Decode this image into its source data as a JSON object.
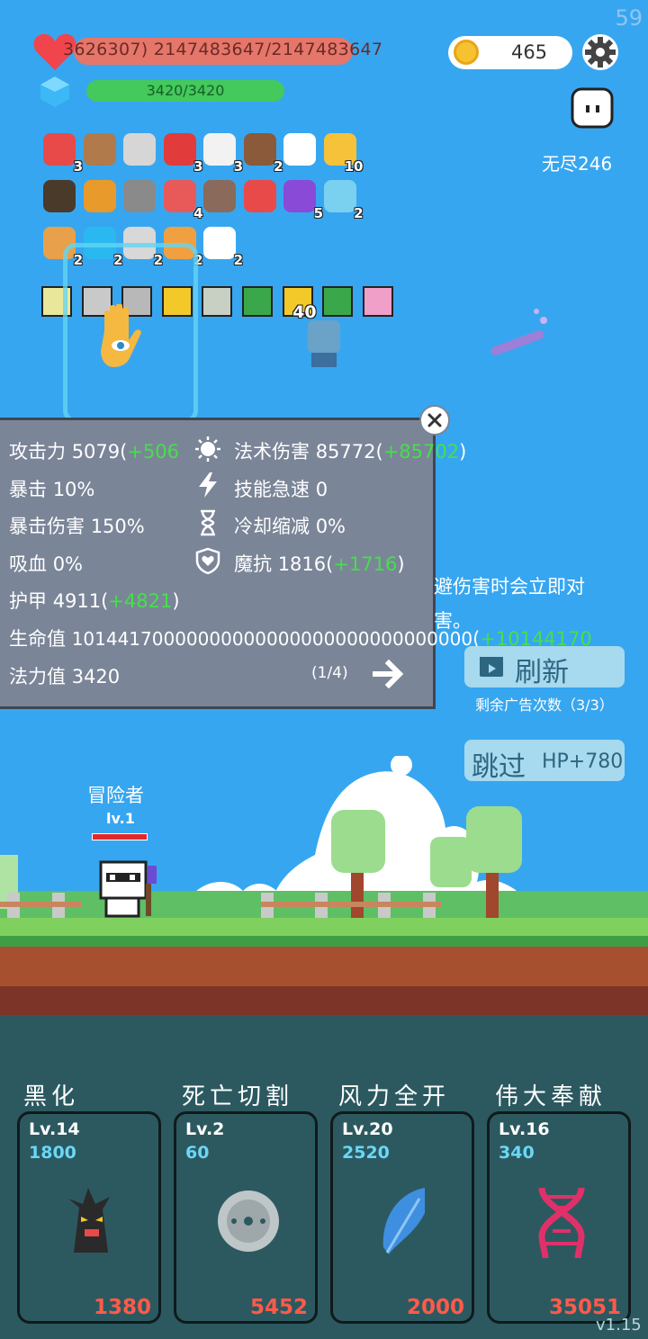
{
  "fps": "59",
  "player_stats": {
    "hp_text": "3626307) 2147483647/2147483647",
    "mp_text": "3420/3420"
  },
  "coins": "465",
  "mode_label": "无尽246",
  "items": [
    {
      "icon": "watermelon-icon",
      "count": "3"
    },
    {
      "icon": "shield-icon",
      "count": ""
    },
    {
      "icon": "sword-icon",
      "count": ""
    },
    {
      "icon": "strawberry-icon",
      "count": "3"
    },
    {
      "icon": "envelope-icon",
      "count": "3"
    },
    {
      "icon": "coconut-icon",
      "count": "2"
    },
    {
      "icon": "crosshair-icon",
      "count": ""
    },
    {
      "icon": "sunflower-icon",
      "count": "10"
    },
    {
      "icon": "cauldron-icon",
      "count": ""
    },
    {
      "icon": "book-icon",
      "count": ""
    },
    {
      "icon": "helmet-icon",
      "count": ""
    },
    {
      "icon": "pill-icon",
      "count": "4"
    },
    {
      "icon": "tombstone-icon",
      "count": ""
    },
    {
      "icon": "badge-icon",
      "count": ""
    },
    {
      "icon": "crystal-ball-icon",
      "count": "5"
    },
    {
      "icon": "potion-icon",
      "count": "2"
    },
    {
      "icon": "drink-icon",
      "count": "2"
    },
    {
      "icon": "gem-icon",
      "count": "2"
    },
    {
      "icon": "hook-icon",
      "count": "2"
    },
    {
      "icon": "meteor-icon",
      "count": "2"
    },
    {
      "icon": "ghost-icon",
      "count": "2"
    }
  ],
  "relics": [
    {
      "icon": "light-relic-icon",
      "count": ""
    },
    {
      "icon": "armor-relic-icon",
      "count": ""
    },
    {
      "icon": "blade-relic-icon",
      "count": ""
    },
    {
      "icon": "dark-relic-icon",
      "count": ""
    },
    {
      "icon": "hammer-relic-icon",
      "count": ""
    },
    {
      "icon": "poison-relic-icon",
      "count": ""
    },
    {
      "icon": "star-relic-icon",
      "count": "40"
    },
    {
      "icon": "rune-relic-icon",
      "count": ""
    },
    {
      "icon": "demon-relic-icon",
      "count": ""
    }
  ],
  "stats_panel": {
    "attack_label": "攻击力",
    "attack_value": "5079",
    "attack_bonus": "+506",
    "spell_label": "法术伤害",
    "spell_value": "85772",
    "spell_bonus": "+85702",
    "crit_label": "暴击",
    "crit_value": "10%",
    "haste_label": "技能急速",
    "haste_value": "0",
    "crit_dmg_label": "暴击伤害",
    "crit_dmg_value": "150%",
    "cdr_label": "冷却缩减",
    "cdr_value": "0%",
    "lifesteal_label": "吸血",
    "lifesteal_value": "0%",
    "mr_label": "魔抗",
    "mr_value": "1816",
    "mr_bonus": "+1716",
    "armor_label": "护甲",
    "armor_value": "4911",
    "armor_bonus": "+4821",
    "hp_label": "生命值",
    "hp_value": "10144170000000000000000000000000000",
    "hp_bonus": "+10144170",
    "mana_label": "法力值",
    "mana_value": "3420",
    "page": "(1/4)"
  },
  "description": {
    "line1": "避伤害时会立即对",
    "line2": "害。"
  },
  "buttons": {
    "refresh_label": "刷新",
    "ads_left": "剩余广告次数（3/3）",
    "skip_label": "跳过",
    "skip_bonus": "HP+780"
  },
  "player": {
    "name": "冒险者",
    "level": "lv.1"
  },
  "skills": [
    {
      "name": "黑化",
      "level": "Lv.14",
      "cost": "1800",
      "value": "1380",
      "icon": "dark-tree-icon"
    },
    {
      "name": "死亡切割",
      "level": "Lv.2",
      "cost": "60",
      "value": "5452",
      "icon": "saw-blade-icon"
    },
    {
      "name": "风力全开",
      "level": "Lv.20",
      "cost": "2520",
      "value": "2000",
      "icon": "feather-icon"
    },
    {
      "name": "伟大奉献",
      "level": "Lv.16",
      "cost": "340",
      "value": "35051",
      "icon": "dna-icon"
    }
  ],
  "version": "v1.15",
  "colors": {
    "sky": "#37a6f0",
    "accent_green": "#44e04a",
    "damage_red": "#ff5a4a",
    "cost_blue": "#6ad7f7"
  }
}
